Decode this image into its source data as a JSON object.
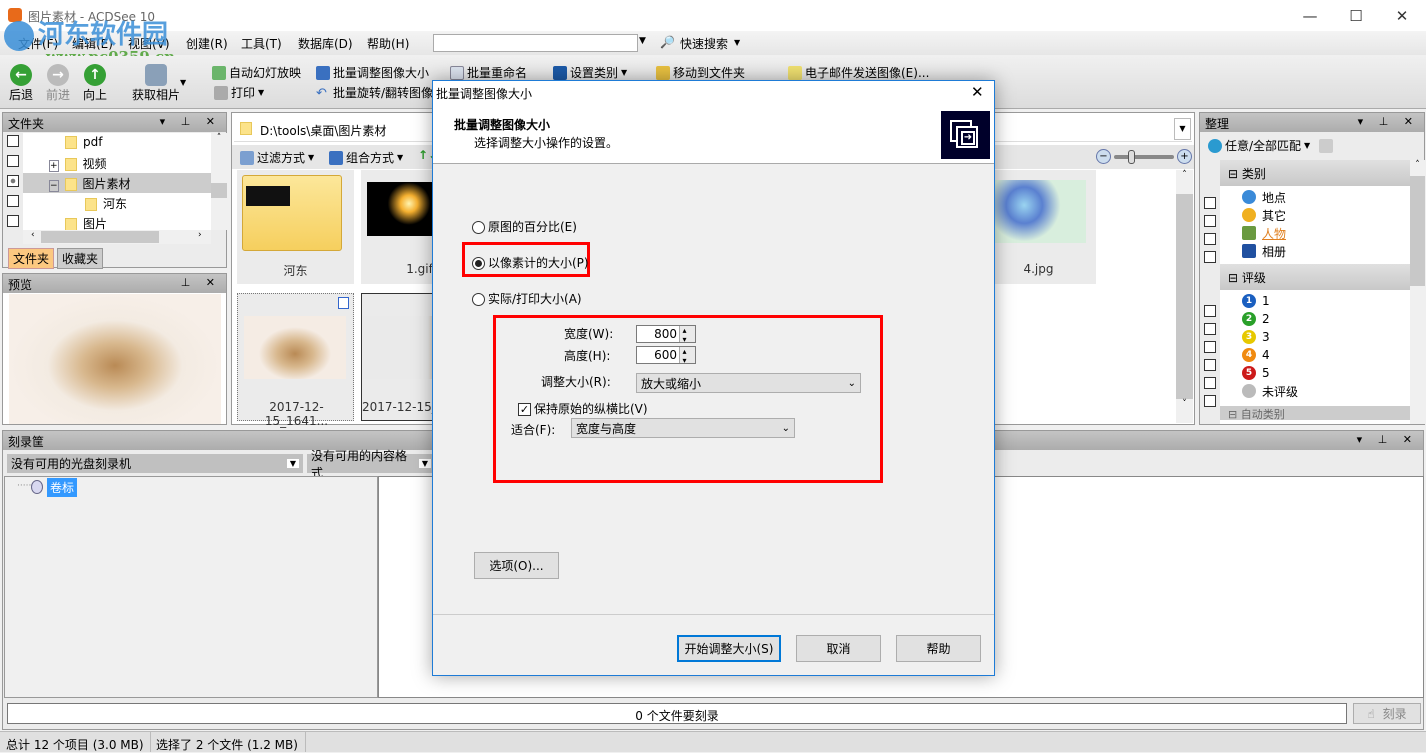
{
  "window": {
    "title": "图片素材 - ACDSee 10",
    "minimize": "—",
    "maximize": "☐",
    "close": "✕"
  },
  "watermark": {
    "name": "河东软件园",
    "url": "www.pc0359.cn"
  },
  "menu": [
    "文件(F)",
    "编辑(E)",
    "视图(V)",
    "创建(R)",
    "工具(T)",
    "数据库(D)",
    "帮助(H)"
  ],
  "search": {
    "value": "",
    "quick_search": "快速搜索"
  },
  "toolbar": {
    "back": "后退",
    "forward": "前进",
    "up": "向上",
    "acquire": "获取相片",
    "slideshow": "自动幻灯放映",
    "batch_resize": "批量调整图像大小",
    "batch_rename": "批量重命名",
    "set_category": "设置类别",
    "move_to_folder": "移动到文件夹",
    "email": "电子邮件发送图像(E)...",
    "print": "打印",
    "batch_rotate": "批量旋转/翻转图像"
  },
  "folders_panel": {
    "title": "文件夹",
    "items": [
      {
        "label": "pdf"
      },
      {
        "label": "视频"
      },
      {
        "label": "图片素材",
        "selected": true
      },
      {
        "label": "河东"
      },
      {
        "label": "图片"
      }
    ],
    "tabs": [
      "文件夹",
      "收藏夹"
    ]
  },
  "preview_panel": {
    "title": "预览"
  },
  "browser": {
    "path": "D:\\tools\\桌面\\图片素材",
    "filter": "过滤方式",
    "group": "组合方式",
    "thumbnails": [
      {
        "label": "河东"
      },
      {
        "label": "1.gif"
      },
      {
        "label": "4.jpg"
      },
      {
        "label": "2017-12-15_1641..."
      },
      {
        "label": "2017-12-15_"
      }
    ]
  },
  "organize_panel": {
    "title": "整理",
    "match": "任意/全部匹配",
    "categories_header": "类别",
    "categories": [
      "地点",
      "其它",
      "人物",
      "相册"
    ],
    "ratings_header": "评级",
    "ratings": [
      "1",
      "2",
      "3",
      "4",
      "5",
      "未评级"
    ],
    "rating_colors": [
      "#1a5fc0",
      "#2aa02a",
      "#e6c800",
      "#f08a10",
      "#cc1a1a",
      "#bbbbbb"
    ],
    "next_header": "自动类别"
  },
  "burn_panel": {
    "title": "刻录筐",
    "burner": "没有可用的光盘刻录机",
    "format": "没有可用的内容格式",
    "volume": "卷标",
    "progress_text": "0 个文件要刻录",
    "progress": 0,
    "burn": "刻录"
  },
  "status": {
    "total": "总计 12 个项目 (3.0 MB)",
    "selected": "选择了 2 个文件 (1.2 MB)"
  },
  "dialog": {
    "title": "批量调整图像大小",
    "header_title": "批量调整图像大小",
    "header_subtitle": "选择调整大小操作的设置。",
    "options": [
      {
        "label": "原图的百分比(E)",
        "checked": false
      },
      {
        "label": "以像素计的大小(P)",
        "checked": true
      },
      {
        "label": "实际/打印大小(A)",
        "checked": false
      }
    ],
    "width_label": "宽度(W):",
    "width_value": "800",
    "height_label": "高度(H):",
    "height_value": "600",
    "resize_label": "调整大小(R):",
    "resize_value": "放大或缩小",
    "keep_ratio_label": "保持原始的纵横比(V)",
    "keep_ratio": true,
    "fit_label": "适合(F):",
    "fit_value": "宽度与高度",
    "options_button": "选项(O)...",
    "start_button": "开始调整大小(S)",
    "cancel_button": "取消",
    "help_button": "帮助",
    "highlight_color": "#ff0000"
  }
}
